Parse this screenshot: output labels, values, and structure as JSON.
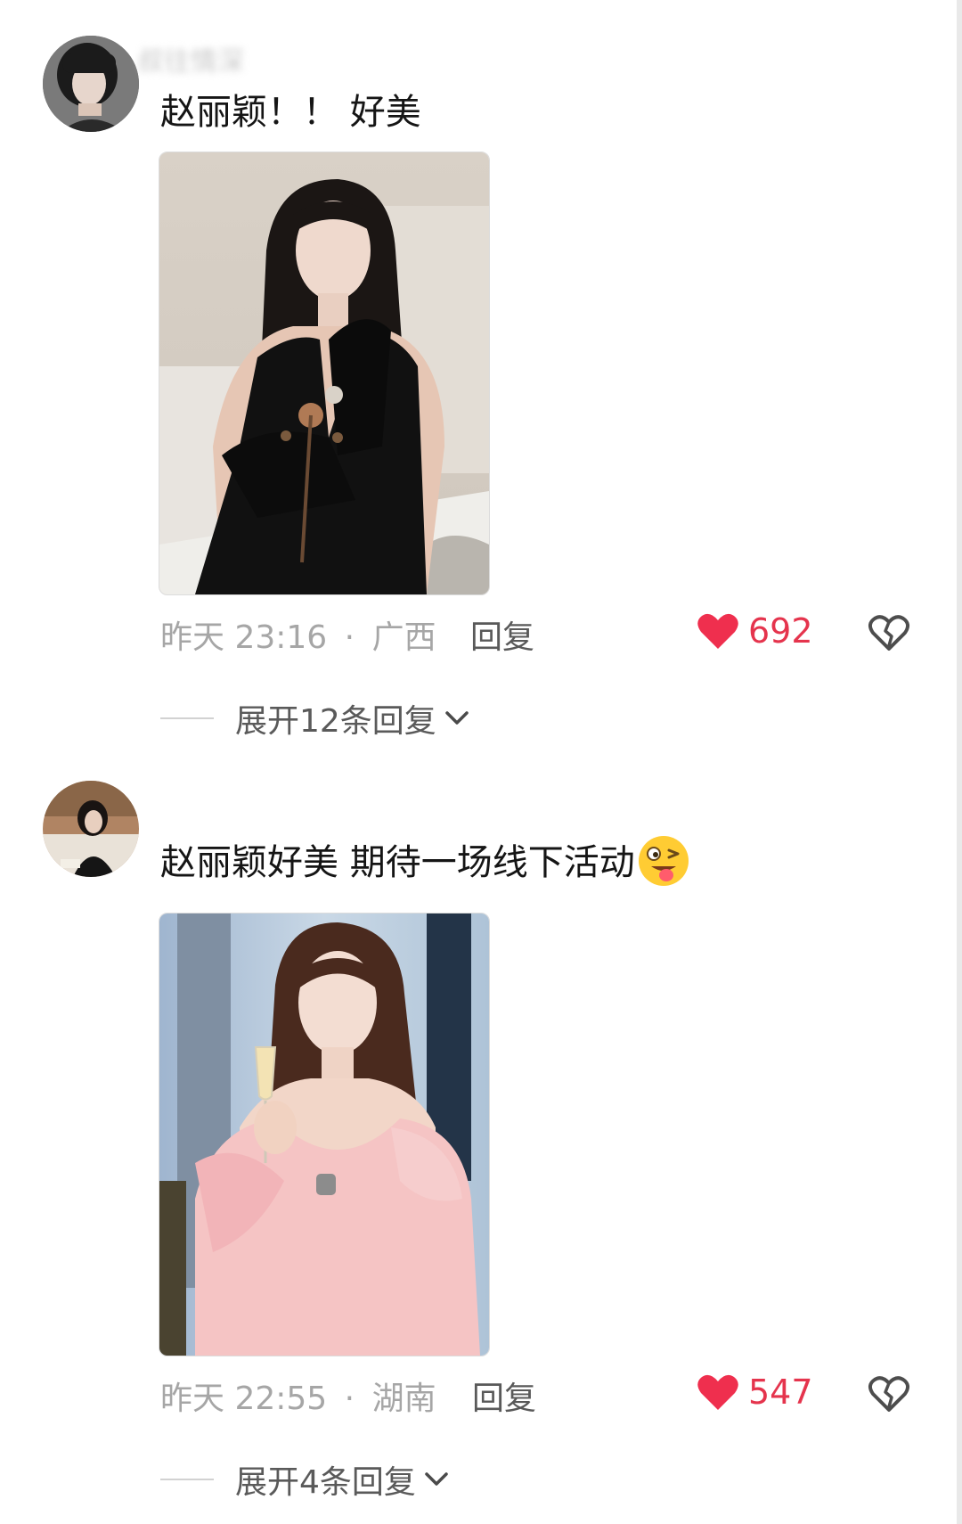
{
  "comments": [
    {
      "username": "叔往情深",
      "text": "赵丽颖！！ 好美",
      "time": "昨天 23:16",
      "separator": "·",
      "location": "广西",
      "reply_label": "回复",
      "likes": "692",
      "expand_label": "展开12条回复",
      "icons": {
        "like": "heart-icon",
        "dislike": "broken-heart-icon",
        "expand": "chevron-down-icon"
      }
    },
    {
      "username": "",
      "text": "赵丽颖好美 期待一场线下活动",
      "emoji": "winking-tongue-emoji",
      "time": "昨天 22:55",
      "separator": "·",
      "location": "湖南",
      "reply_label": "回复",
      "likes": "547",
      "expand_label": "展开4条回复",
      "icons": {
        "like": "heart-icon",
        "dislike": "broken-heart-icon",
        "expand": "chevron-down-icon"
      }
    }
  ],
  "colors": {
    "like_red": "#e5344d",
    "meta_gray": "#a6a6a6",
    "text_dark": "#151515"
  }
}
